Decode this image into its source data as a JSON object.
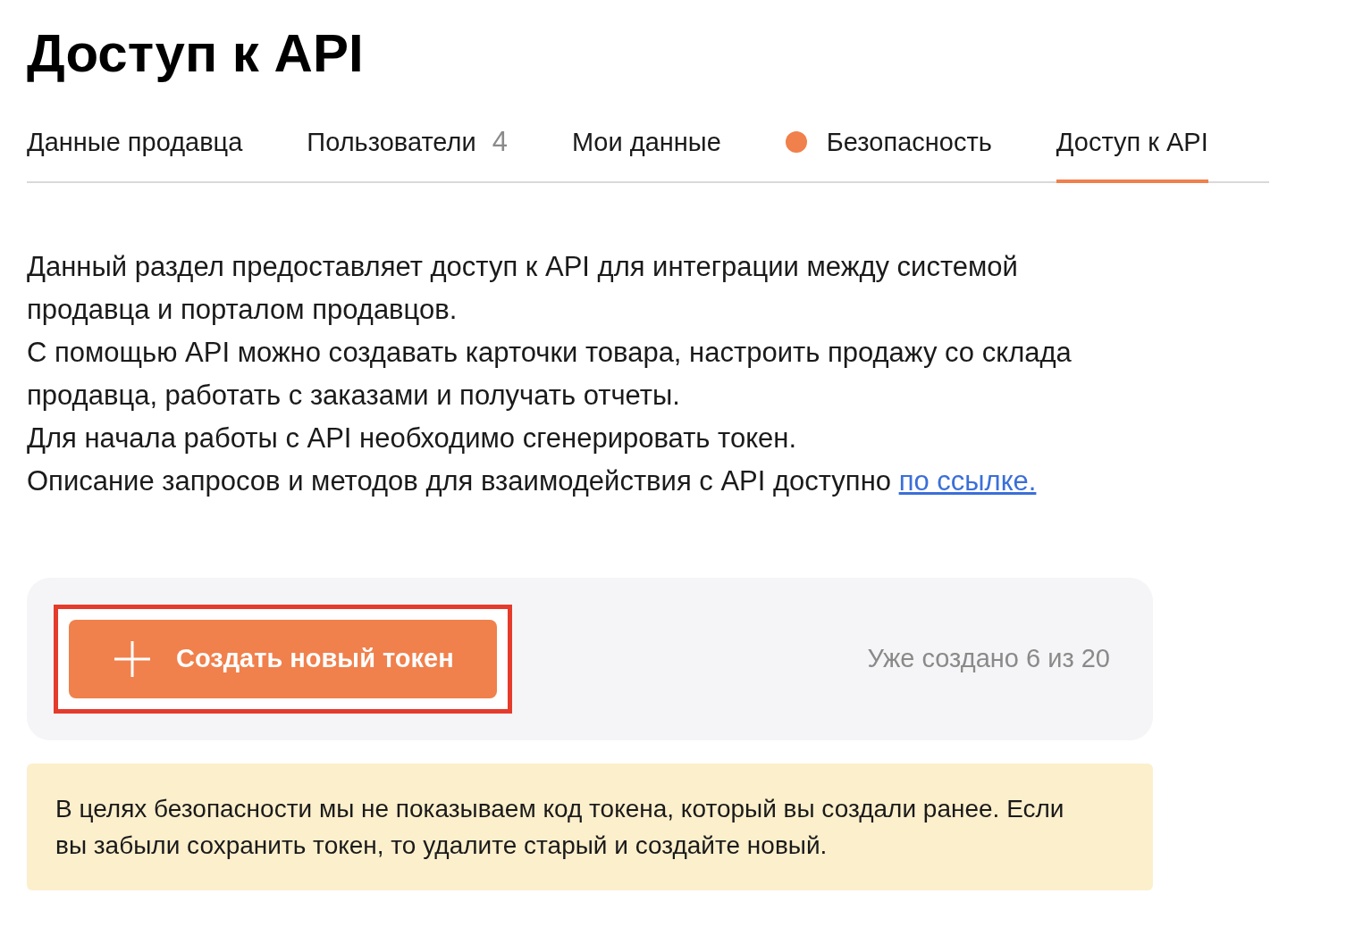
{
  "title": "Доступ к API",
  "tabs": [
    {
      "label": "Данные продавца",
      "selected": false
    },
    {
      "label": "Пользователи",
      "count": "4",
      "selected": false
    },
    {
      "label": "Мои данные",
      "selected": false
    },
    {
      "label": "Безопасность",
      "alert_dot": true,
      "selected": false
    },
    {
      "label": "Доступ к API",
      "selected": true
    }
  ],
  "description": [
    "Данный раздел предоставляет доступ к API для интеграции между системой продавца и порталом продавцов.",
    "С помощью API можно создавать карточки товара, настроить продажу со склада продавца, работать с заказами и получать отчеты.",
    "Для начала работы с API необходимо сгенерировать токен.",
    "Описание запросов и методов для взаимодействия с API доступно"
  ],
  "description_link": "по ссылке.",
  "create_button": {
    "label": "Создать новый токен",
    "highlighted": true
  },
  "token_counter": "Уже создано 6 из 20",
  "notice": "В целях безопасности мы не показываем код токена, который вы создали ранее. Если вы забыли сохранить токен, то удалите старый и создайте новый."
}
